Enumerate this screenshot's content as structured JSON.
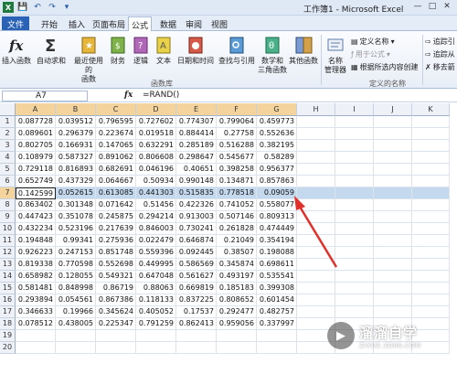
{
  "titlebar": {
    "title": "工作簿1 - Microsoft Excel"
  },
  "tabs": [
    {
      "label": "文件"
    },
    {
      "label": "开始"
    },
    {
      "label": "插入"
    },
    {
      "label": "页面布局"
    },
    {
      "label": "公式"
    },
    {
      "label": "数据"
    },
    {
      "label": "审阅"
    },
    {
      "label": "视图"
    }
  ],
  "ribbon": {
    "insert_function": "插入函数",
    "autosum": "自动求和",
    "recent": "最近使用的",
    "recent2": "函数",
    "financial": "财务",
    "logical": "逻辑",
    "text": "文本",
    "datetime": "日期和时间",
    "lookup": "查找与引用",
    "math": "数学和",
    "math2": "三角函数",
    "other": "其他函数",
    "group_library": "函数库",
    "name_manager": "名称",
    "name_manager2": "管理器",
    "define_name": "定义名称",
    "use_in_formula": "用于公式",
    "create_from_sel": "根据所选内容创建",
    "group_names": "定义的名称",
    "trace_prec": "追踪引",
    "trace_dep": "追踪从",
    "remove_arrows": "移去箭"
  },
  "formula_bar": {
    "name_box": "A7",
    "fx": "fx",
    "formula": "=RAND()"
  },
  "columns": [
    "A",
    "B",
    "C",
    "D",
    "E",
    "F",
    "G",
    "H",
    "I",
    "J",
    "K"
  ],
  "rows": [
    {
      "n": "1",
      "v": [
        "0.087728",
        "0.039512",
        "0.796595",
        "0.727602",
        "0.774307",
        "0.799064",
        "0.459773"
      ]
    },
    {
      "n": "2",
      "v": [
        "0.089601",
        "0.296379",
        "0.223674",
        "0.019518",
        "0.884414",
        "0.27758",
        "0.552636"
      ]
    },
    {
      "n": "3",
      "v": [
        "0.802705",
        "0.166931",
        "0.147065",
        "0.632291",
        "0.285189",
        "0.516288",
        "0.382195"
      ]
    },
    {
      "n": "4",
      "v": [
        "0.108979",
        "0.587327",
        "0.891062",
        "0.806608",
        "0.298647",
        "0.545677",
        "0.58289"
      ]
    },
    {
      "n": "5",
      "v": [
        "0.729118",
        "0.816893",
        "0.682691",
        "0.046196",
        "0.40651",
        "0.398258",
        "0.956377"
      ]
    },
    {
      "n": "6",
      "v": [
        "0.652749",
        "0.437329",
        "0.064667",
        "0.50934",
        "0.990148",
        "0.134871",
        "0.857863"
      ]
    },
    {
      "n": "7",
      "v": [
        "0.142599",
        "0.052615",
        "0.613085",
        "0.441303",
        "0.515835",
        "0.778518",
        "0.09059"
      ]
    },
    {
      "n": "8",
      "v": [
        "0.863402",
        "0.301348",
        "0.071642",
        "0.51456",
        "0.422326",
        "0.741052",
        "0.558077"
      ]
    },
    {
      "n": "9",
      "v": [
        "0.447423",
        "0.351078",
        "0.245875",
        "0.294214",
        "0.913003",
        "0.507146",
        "0.809313"
      ]
    },
    {
      "n": "10",
      "v": [
        "0.432234",
        "0.523196",
        "0.217639",
        "0.846003",
        "0.730241",
        "0.261828",
        "0.474449"
      ]
    },
    {
      "n": "11",
      "v": [
        "0.194848",
        "0.99341",
        "0.275936",
        "0.022479",
        "0.646874",
        "0.21049",
        "0.354194"
      ]
    },
    {
      "n": "12",
      "v": [
        "0.926223",
        "0.247153",
        "0.851748",
        "0.559396",
        "0.092445",
        "0.38507",
        "0.198088"
      ]
    },
    {
      "n": "13",
      "v": [
        "0.819338",
        "0.770598",
        "0.552698",
        "0.449995",
        "0.586569",
        "0.345874",
        "0.698611"
      ]
    },
    {
      "n": "14",
      "v": [
        "0.658982",
        "0.128055",
        "0.549321",
        "0.647048",
        "0.561627",
        "0.493197",
        "0.535541"
      ]
    },
    {
      "n": "15",
      "v": [
        "0.581481",
        "0.848998",
        "0.86719",
        "0.88063",
        "0.669819",
        "0.185183",
        "0.399308"
      ]
    },
    {
      "n": "16",
      "v": [
        "0.293894",
        "0.054561",
        "0.867386",
        "0.118133",
        "0.837225",
        "0.808652",
        "0.601454"
      ]
    },
    {
      "n": "17",
      "v": [
        "0.346633",
        "0.19966",
        "0.345624",
        "0.405052",
        "0.17537",
        "0.292477",
        "0.482757"
      ]
    },
    {
      "n": "18",
      "v": [
        "0.078512",
        "0.438005",
        "0.225347",
        "0.791259",
        "0.862413",
        "0.959056",
        "0.337997"
      ]
    },
    {
      "n": "19",
      "v": []
    },
    {
      "n": "20",
      "v": []
    }
  ],
  "watermark": {
    "main": "溜溜自学",
    "sub": "ZIXUE.3D66.COM"
  }
}
